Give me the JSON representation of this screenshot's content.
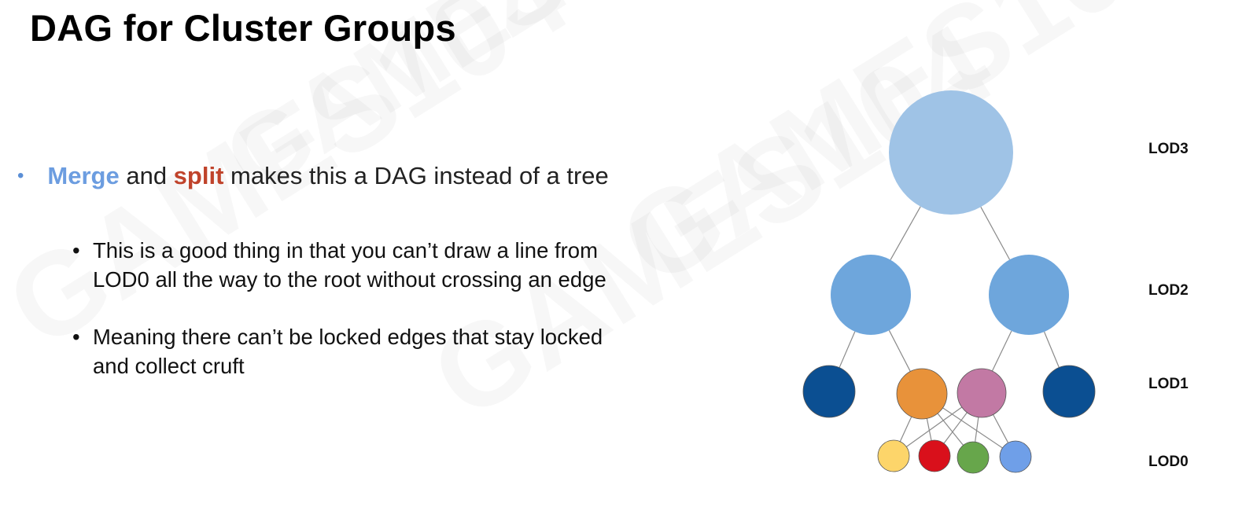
{
  "slide": {
    "title": "DAG for Cluster Groups",
    "watermark": "GAMES104"
  },
  "bullets": {
    "main": {
      "marker": "•",
      "merge": "Merge",
      "and": " and ",
      "split": "split",
      "rest": " makes this a DAG instead of a tree"
    },
    "sub": [
      {
        "marker": "•",
        "line1": "This is a good thing in that you can’t draw a line from",
        "line2": "LOD0 all the way to the root without crossing an edge"
      },
      {
        "marker": "•",
        "line1": "Meaning there can’t be locked edges that stay locked",
        "line2": "and collect cruft"
      }
    ]
  },
  "colors": {
    "merge": "#6c9de0",
    "split": "#c0432b",
    "lod3": "#9fc3e6",
    "lod2": "#6ea6dc",
    "lod1_outer": "#0b4f92",
    "lod1_orange": "#e8923a",
    "lod1_pink": "#c279a4",
    "lod0_yellow": "#fdd56a",
    "lod0_red": "#d9101b",
    "lod0_green": "#67a64b",
    "lod0_blue": "#6f9fe8",
    "edge": "#8a8a8a"
  },
  "diagram": {
    "levels": [
      "LOD3",
      "LOD2",
      "LOD1",
      "LOD0"
    ],
    "nodes": [
      {
        "id": "lod3-root",
        "level": "LOD3",
        "color": "lod3"
      },
      {
        "id": "lod2-left",
        "level": "LOD2",
        "color": "lod2"
      },
      {
        "id": "lod2-right",
        "level": "LOD2",
        "color": "lod2"
      },
      {
        "id": "lod1-outer-left",
        "level": "LOD1",
        "color": "lod1_outer"
      },
      {
        "id": "lod1-orange",
        "level": "LOD1",
        "color": "lod1_orange"
      },
      {
        "id": "lod1-pink",
        "level": "LOD1",
        "color": "lod1_pink"
      },
      {
        "id": "lod1-outer-right",
        "level": "LOD1",
        "color": "lod1_outer"
      },
      {
        "id": "lod0-yellow",
        "level": "LOD0",
        "color": "lod0_yellow"
      },
      {
        "id": "lod0-red",
        "level": "LOD0",
        "color": "lod0_red"
      },
      {
        "id": "lod0-green",
        "level": "LOD0",
        "color": "lod0_green"
      },
      {
        "id": "lod0-blue",
        "level": "LOD0",
        "color": "lod0_blue"
      }
    ],
    "edges": [
      [
        "lod3-root",
        "lod2-left"
      ],
      [
        "lod3-root",
        "lod2-right"
      ],
      [
        "lod2-left",
        "lod1-outer-left"
      ],
      [
        "lod2-left",
        "lod1-orange"
      ],
      [
        "lod2-right",
        "lod1-pink"
      ],
      [
        "lod2-right",
        "lod1-outer-right"
      ],
      [
        "lod1-orange",
        "lod0-yellow"
      ],
      [
        "lod1-orange",
        "lod0-red"
      ],
      [
        "lod1-orange",
        "lod0-green"
      ],
      [
        "lod1-orange",
        "lod0-blue"
      ],
      [
        "lod1-pink",
        "lod0-yellow"
      ],
      [
        "lod1-pink",
        "lod0-red"
      ],
      [
        "lod1-pink",
        "lod0-green"
      ],
      [
        "lod1-pink",
        "lod0-blue"
      ]
    ]
  }
}
